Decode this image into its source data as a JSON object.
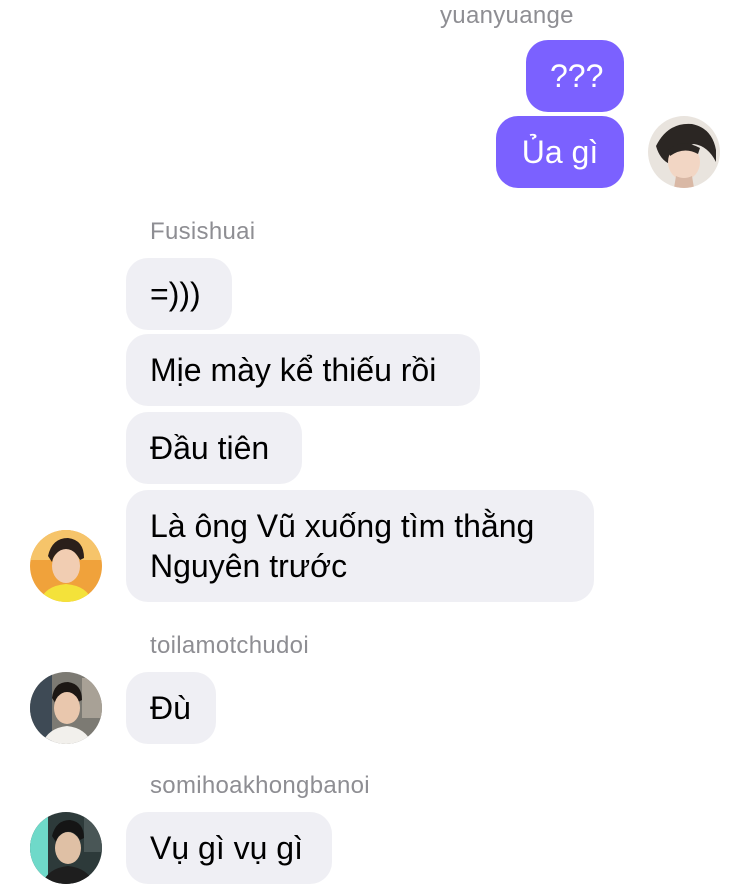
{
  "messages": {
    "group1": {
      "sender": "yuanyuange",
      "bubble1": "???",
      "bubble2": "Ủa gì"
    },
    "group2": {
      "sender": "Fusishuai",
      "bubble1": "=)))",
      "bubble2": "Mịe mày kể thiếu rồi",
      "bubble3": "Đầu tiên",
      "bubble4": "Là ông Vũ xuống tìm thằng Nguyên trước"
    },
    "group3": {
      "sender": "toilamotchudoi",
      "bubble1": "Đù"
    },
    "group4": {
      "sender": "somihoakhongbanoi",
      "bubble1": "Vụ gì vụ gì"
    }
  },
  "colors": {
    "outgoing_bubble": "#7b61ff",
    "incoming_bubble": "#efeff4",
    "sender_name": "#8e8e93"
  }
}
